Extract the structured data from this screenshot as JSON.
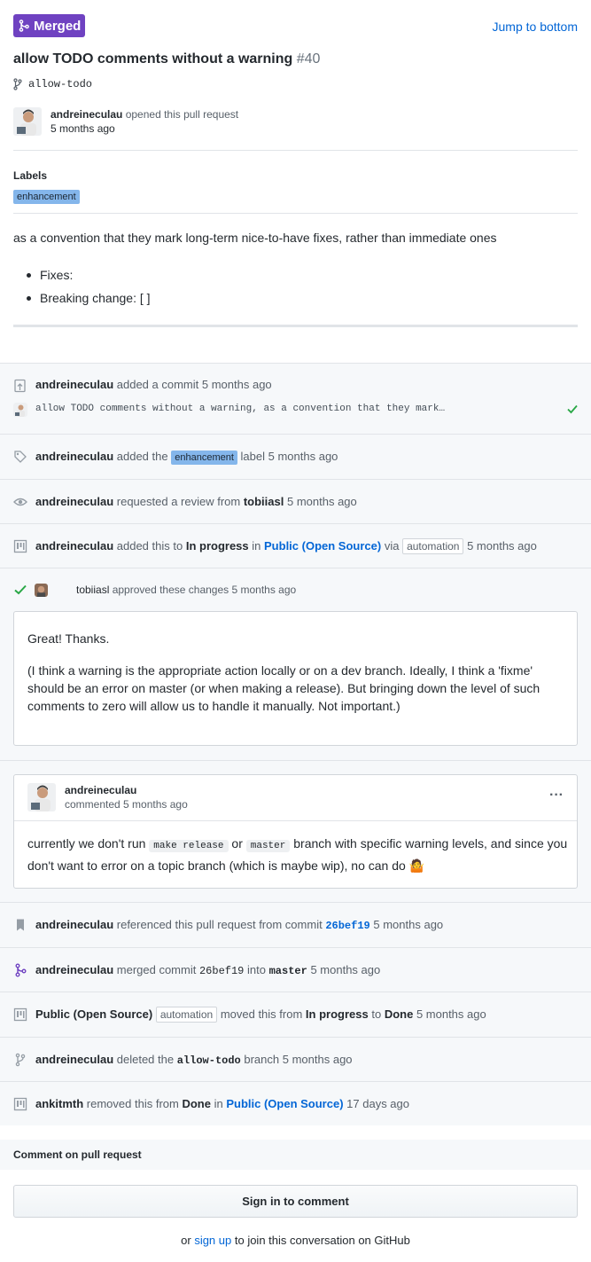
{
  "header": {
    "status_badge": "Merged",
    "jump_label": "Jump to bottom",
    "title": "allow TODO comments without a warning",
    "number": "#40",
    "branch": "allow-todo"
  },
  "opener": {
    "user": "andreineculau",
    "action": "opened this pull request",
    "time": "5 months ago"
  },
  "labels": {
    "heading": "Labels",
    "items": [
      "enhancement"
    ]
  },
  "description": {
    "text": "as a convention that they mark long-term nice-to-have fixes, rather than immediate ones",
    "bullets": [
      "Fixes:",
      "Breaking change: [ ]"
    ]
  },
  "timeline": {
    "commit_event": {
      "user": "andreineculau",
      "action": "added a commit",
      "time": "5 months ago",
      "message": "allow TODO comments without a warning, as a convention that they mark…"
    },
    "label_event": {
      "user": "andreineculau",
      "pre": "added the",
      "label": "enhancement",
      "post": "label",
      "time": "5 months ago"
    },
    "review_request": {
      "user": "andreineculau",
      "pre": "requested a review from",
      "reviewer": "tobiiasl",
      "time": "5 months ago"
    },
    "project_add": {
      "user": "andreineculau",
      "pre": "added this to",
      "column": "In progress",
      "in": "in",
      "project": "Public (Open Source)",
      "via": "via",
      "automation": "automation",
      "time": "5 months ago"
    },
    "approval": {
      "user": "tobiiasl",
      "action": "approved these changes",
      "time": "5 months ago",
      "p1": "Great! Thanks.",
      "p2": "(I think a warning is the appropriate action locally or on a dev branch. Ideally, I think a 'fixme' should be an error on master (or when making a release). But bringing down the level of such comments to zero will allow us to handle it manually. Not important.)"
    },
    "comment": {
      "user": "andreineculau",
      "action": "commented",
      "time": "5 months ago",
      "menu": "···",
      "t1": "currently we don't run",
      "code1": "make release",
      "t2": "or",
      "code2": "master",
      "t3": "branch with specific warning levels, and since you",
      "t4": "don't want to error on a topic branch (which is maybe wip), no can do",
      "emoji": "🤷"
    },
    "reference": {
      "user": "andreineculau",
      "pre": "referenced this pull request from commit",
      "sha": "26bef19",
      "time": "5 months ago"
    },
    "merge": {
      "user": "andreineculau",
      "pre": "merged commit",
      "sha": "26bef19",
      "into": "into",
      "branch": "master",
      "time": "5 months ago"
    },
    "moved": {
      "project": "Public (Open Source)",
      "automation": "automation",
      "pre": "moved this from",
      "from": "In progress",
      "to_word": "to",
      "to": "Done",
      "time": "5 months ago"
    },
    "deleted": {
      "user": "andreineculau",
      "pre": "deleted the",
      "branch": "allow-todo",
      "post": "branch",
      "time": "5 months ago"
    },
    "removed": {
      "user": "ankitmth",
      "pre": "removed this from",
      "column": "Done",
      "in": "in",
      "project": "Public (Open Source)",
      "time": "17 days ago"
    }
  },
  "footer": {
    "comment_heading": "Comment on pull request",
    "signin_label": "Sign in to comment",
    "or": "or",
    "signup": "sign up",
    "rest": "to join this conversation on GitHub"
  },
  "colors": {
    "merged": "#6f42c1",
    "link": "#0366d6",
    "label": "#84b6eb",
    "success": "#28a745"
  }
}
